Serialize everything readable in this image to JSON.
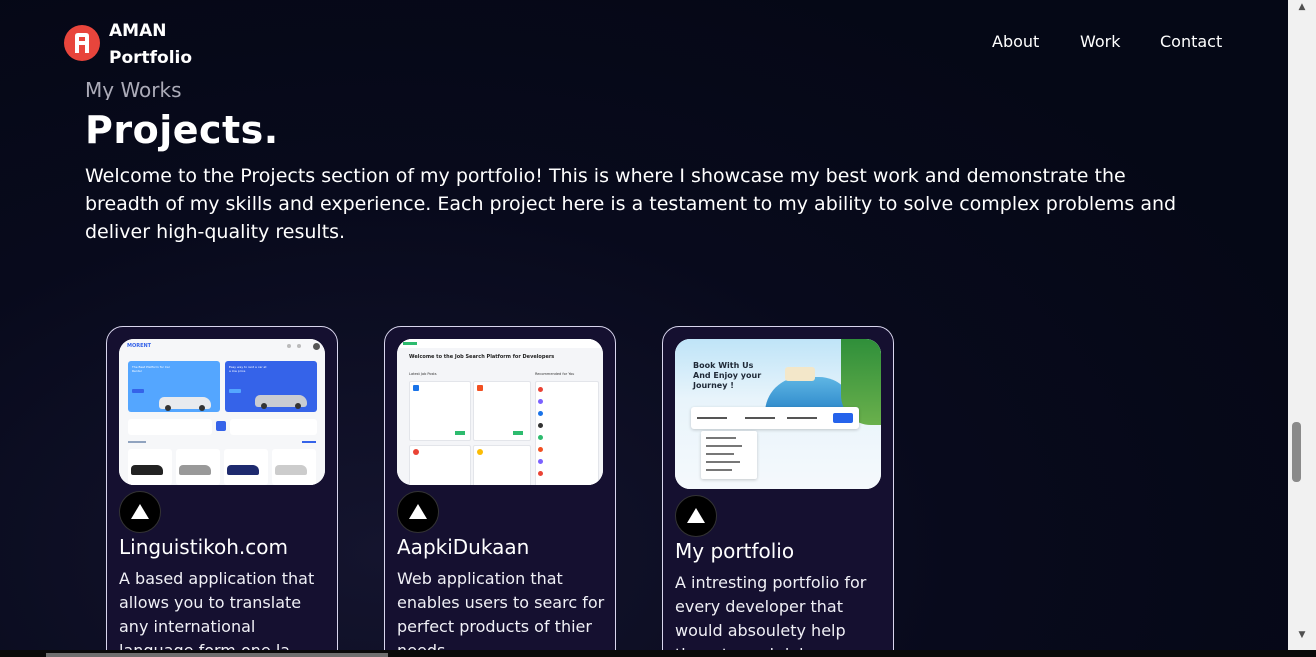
{
  "navbar": {
    "brand_line1": "AMAN",
    "brand_line2": "Portfolio",
    "links": [
      "About",
      "Work",
      "Contact"
    ]
  },
  "section": {
    "subtitle": "My Works",
    "title": "Projects.",
    "intro": "Welcome to the Projects section of my portfolio! This is where I showcase my best work and demonstrate the breadth of my skills and experience. Each project here is a testament to my ability to solve complex problems and deliver high-quality results."
  },
  "projects": [
    {
      "name": "Linguistikoh.com",
      "description": "A based application that allows you to translate any international language form one la",
      "thumb": {
        "brand": "MORENT",
        "banner1": "The Best Platform for Car Rental",
        "banner2": "Easy way to rent a car at a low price"
      }
    },
    {
      "name": "AapkiDukaan",
      "description": "Web application that enables users to searc for perfect products of thier needs",
      "thumb": {
        "heading": "Welcome to the Job Search Platform for Developers",
        "left_label": "Latest Job Posts",
        "right_label": "Recommended for You"
      }
    },
    {
      "name": "My portfolio",
      "description": "A intresting portfolio for every developer that would absoulety help them to grab job",
      "thumb": {
        "headline": "Book With Us And Enjoy your Journey !"
      }
    }
  ],
  "icons": {
    "logo": "logo-badge-icon",
    "project_link": "github-triangle-icon"
  },
  "colors": {
    "background": "#050816",
    "card_bg": "#151030",
    "card_border": "#d9d6ee",
    "logo": "#e8453c"
  }
}
